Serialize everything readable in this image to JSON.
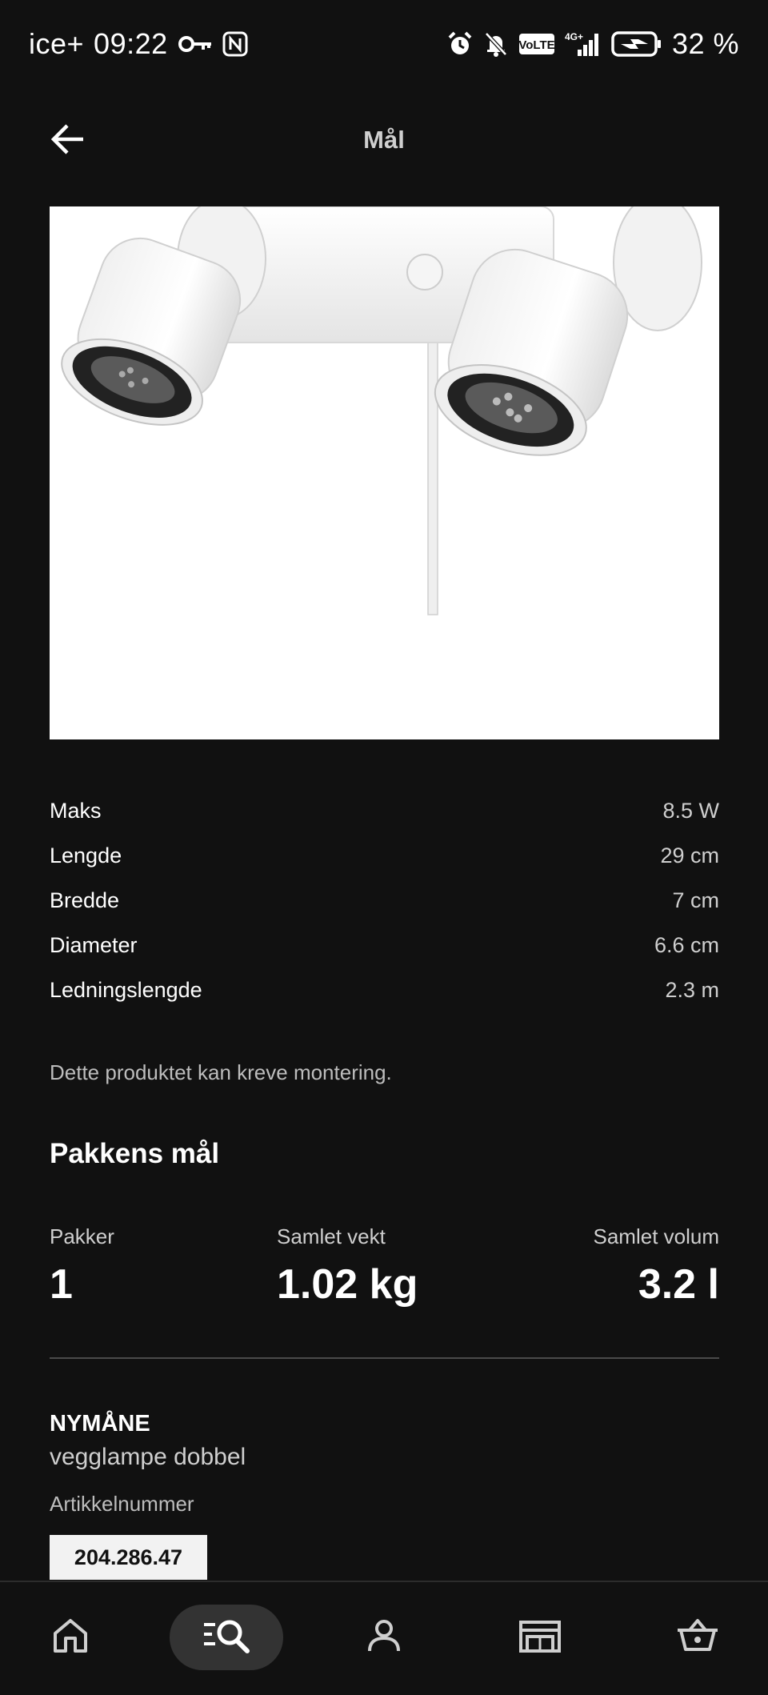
{
  "status_bar": {
    "carrier": "ice+",
    "time": "09:22",
    "battery": "32 %"
  },
  "header": {
    "title": "Mål"
  },
  "specs": [
    {
      "label": "Maks",
      "value": "8.5 W"
    },
    {
      "label": "Lengde",
      "value": "29 cm"
    },
    {
      "label": "Bredde",
      "value": "7 cm"
    },
    {
      "label": "Diameter",
      "value": "6.6 cm"
    },
    {
      "label": "Ledningslengde",
      "value": "2.3 m"
    }
  ],
  "note": "Dette produktet kan kreve montering.",
  "package": {
    "title": "Pakkens mål",
    "packages_label": "Pakker",
    "packages_value": "1",
    "weight_label": "Samlet vekt",
    "weight_value": "1.02 kg",
    "volume_label": "Samlet volum",
    "volume_value": "3.2 l"
  },
  "product": {
    "name": "NYMÅNE",
    "description": "vegglampe dobbel",
    "article_label": "Artikkelnummer",
    "article_number": "204.286.47"
  },
  "bottom_nav": {
    "active": "search",
    "items": [
      {
        "id": "home",
        "icon": "home-icon"
      },
      {
        "id": "search",
        "icon": "search-icon"
      },
      {
        "id": "profile",
        "icon": "profile-icon"
      },
      {
        "id": "store",
        "icon": "store-icon"
      },
      {
        "id": "cart",
        "icon": "cart-icon"
      }
    ]
  },
  "colors": {
    "background": "#111111",
    "text_primary": "#ffffff",
    "text_secondary": "#cfcfcf",
    "nav_active": "#333333",
    "article_badge": "#f2f2f2"
  }
}
